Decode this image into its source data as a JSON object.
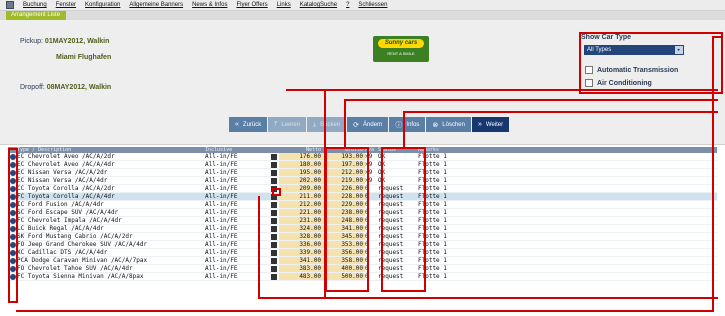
{
  "menu": {
    "items": [
      "Buchung",
      "Fenster",
      "Konfiguration",
      "Allgemeine Banners",
      "News & Infos",
      "Flyer Offers",
      "Links",
      "KatalogSuche",
      "?",
      "Schliessen"
    ]
  },
  "tab": {
    "label": "Arrangement Liste"
  },
  "booking": {
    "pickup_label": "Pickup:",
    "pickup_date": "01MAY2012, Walkin",
    "pickup_location": "Miami Flughafen",
    "dropoff_label": "Dropoff:",
    "dropoff_date": "08MAY2012, Walkin"
  },
  "logo": {
    "brand": "Sunny cars",
    "tagline": "RENT A SMILE"
  },
  "car_type": {
    "title": "Show Car Type",
    "selected": "All Types",
    "options": [
      "Automatic Transmission",
      "Air Conditioning"
    ]
  },
  "buttons": {
    "zurueck": "Zurück",
    "b2": "Leeren",
    "b3": "Bucken",
    "aendern": "Ändern",
    "infos": "Infos",
    "loeschen": "Löschen",
    "weiter": "Weiter"
  },
  "table": {
    "headers": [
      "Type / Description",
      "Inclusive",
      "",
      "Netto",
      "Brutto",
      "Ava",
      "Status",
      "Remarks"
    ],
    "rows": [
      {
        "code": "EC",
        "desc": "Chevrolet Aveo /AC/A/2dr",
        "incl": "All-in/FE",
        "p1": "176.00",
        "p2": "193.00",
        "av": ">9",
        "st": "OK",
        "rm": "Flotte 1",
        "sel": false
      },
      {
        "code": "EC",
        "desc": "Chevrolet Aveo /AC/A/4dr",
        "incl": "All-in/FE",
        "p1": "180.00",
        "p2": "197.00",
        "av": ">9",
        "st": "OK",
        "rm": "Flotte 1",
        "sel": false
      },
      {
        "code": "EC",
        "desc": "Nissan Versa /AC/A/2dr",
        "incl": "All-in/FE",
        "p1": "195.00",
        "p2": "212.00",
        "av": ">9",
        "st": "OK",
        "rm": "Flotte 1",
        "sel": false
      },
      {
        "code": "EC",
        "desc": "Nissan Versa /AC/A/4dr",
        "incl": "All-in/FE",
        "p1": "202.00",
        "p2": "219.00",
        "av": ">9",
        "st": "OK",
        "rm": "Flotte 1",
        "sel": false
      },
      {
        "code": "CC",
        "desc": "Toyota Corolla /AC/A/2dr",
        "incl": "All-in/FE",
        "p1": "209.00",
        "p2": "226.00",
        "av": "0",
        "st": "request",
        "rm": "Flotte 1",
        "sel": false
      },
      {
        "code": "FC",
        "desc": "Toyota Corolla /AC/A/4dr",
        "incl": "All-in/FE",
        "p1": "211.00",
        "p2": "228.00",
        "av": "0",
        "st": "request",
        "rm": "Flotte 1",
        "sel": true
      },
      {
        "code": "IC",
        "desc": "Ford Fusion /AC/A/4dr",
        "incl": "All-in/FE",
        "p1": "212.00",
        "p2": "229.00",
        "av": "0",
        "st": "request",
        "rm": "Flotte 1",
        "sel": false
      },
      {
        "code": "SC",
        "desc": "Ford Escape SUV /AC/A/4dr",
        "incl": "All-in/FE",
        "p1": "221.00",
        "p2": "238.00",
        "av": "0",
        "st": "request",
        "rm": "Flotte 1",
        "sel": false
      },
      {
        "code": "FC",
        "desc": "Chevrolet Impala /AC/A/4dr",
        "incl": "All-in/FE",
        "p1": "231.00",
        "p2": "248.00",
        "av": "0",
        "st": "request",
        "rm": "Flotte 1",
        "sel": false
      },
      {
        "code": "LC",
        "desc": "Buick Regal /AC/A/4dr",
        "incl": "All-in/FE",
        "p1": "324.00",
        "p2": "341.00",
        "av": "0",
        "st": "request",
        "rm": "Flotte 1",
        "sel": false
      },
      {
        "code": "SK",
        "desc": "Ford Mustang Cabrio /AC/A/2dr",
        "incl": "All-in/FE",
        "p1": "328.00",
        "p2": "345.00",
        "av": "0",
        "st": "request",
        "rm": "Flotte 1",
        "sel": false
      },
      {
        "code": "FO",
        "desc": "Jeep Grand Cherokee SUV /AC/A/4dr",
        "incl": "All-in/FE",
        "p1": "336.00",
        "p2": "353.00",
        "av": "0",
        "st": "request",
        "rm": "Flotte 1",
        "sel": false
      },
      {
        "code": "XC",
        "desc": "Cadillac DTS /AC/A/4dr",
        "incl": "All-in/FE",
        "p1": "339.00",
        "p2": "356.00",
        "av": "0",
        "st": "request",
        "rm": "Flotte 1",
        "sel": false
      },
      {
        "code": "PCA",
        "desc": "Dodge Caravan Minivan /AC/A/7pax",
        "incl": "All-in/FE",
        "p1": "341.00",
        "p2": "358.00",
        "av": "0",
        "st": "request",
        "rm": "Flotte 1",
        "sel": false
      },
      {
        "code": "FO",
        "desc": "Chevrolet Tahoe SUV /AC/A/4dr",
        "incl": "All-in/FE",
        "p1": "383.00",
        "p2": "400.00",
        "av": "0",
        "st": "request",
        "rm": "Flotte 1",
        "sel": false
      },
      {
        "code": "FC",
        "desc": "Toyota Sienna Minivan /AC/A/8pax",
        "incl": "All-in/FE",
        "p1": "483.00",
        "p2": "500.00",
        "av": "0",
        "st": "request",
        "rm": "Flotte 1",
        "sel": false
      }
    ]
  },
  "colors": {
    "menu_accent": "#9fbb2a",
    "button_primary": "#17386f",
    "annotation_red": "#d10000",
    "price_highlight": "#f5e2ad"
  }
}
